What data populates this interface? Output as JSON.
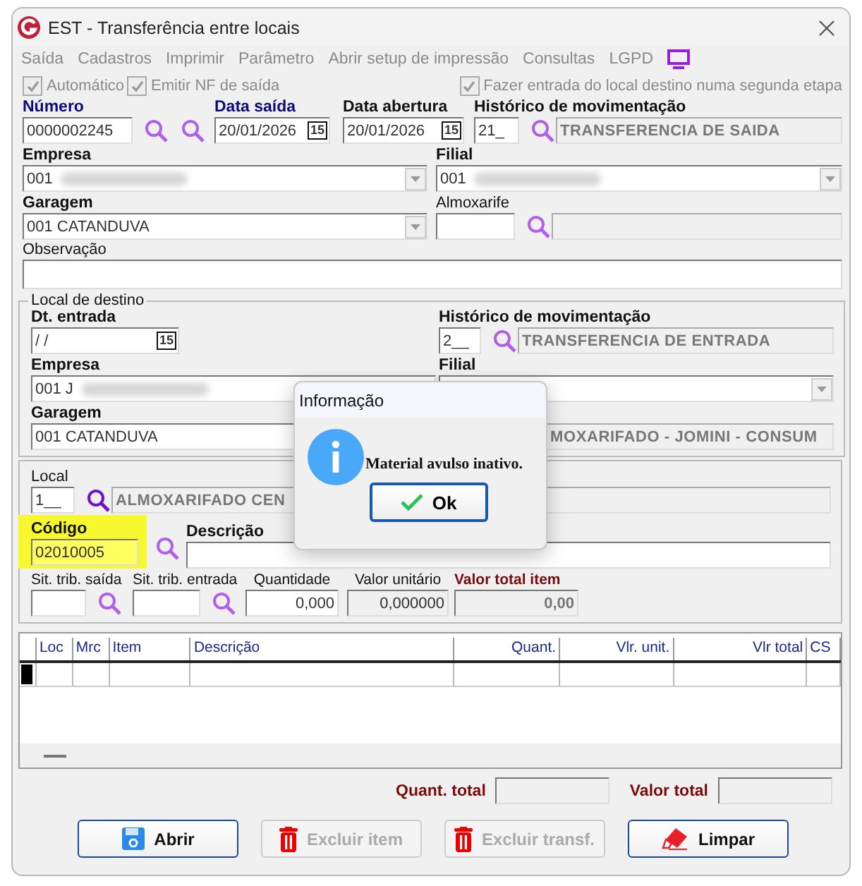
{
  "window": {
    "title": "EST - Transferência entre locais"
  },
  "menu": [
    {
      "label": "Saída"
    },
    {
      "label": "Cadastros"
    },
    {
      "label": "Imprimir"
    },
    {
      "label": "Parâmetro"
    },
    {
      "label": "Abrir setup de impressão"
    },
    {
      "label": "Consultas"
    },
    {
      "label": "LGPD"
    }
  ],
  "options": [
    {
      "label": "Automático",
      "checked": true,
      "disabled": true
    },
    {
      "label": "Emitir NF de saída",
      "checked": true,
      "disabled": true
    }
  ],
  "option_right": {
    "label": "Fazer entrada do local destino numa segunda etapa",
    "checked": true,
    "disabled": true
  },
  "numero": {
    "label": "Número",
    "value": "0000002245"
  },
  "data_saida": {
    "label": "Data saída",
    "value": "20/01/2026",
    "calendar": "15"
  },
  "data_abertura": {
    "label": "Data abertura",
    "value": "20/01/2026",
    "calendar": "15"
  },
  "historico": {
    "label": "Histórico de movimentação",
    "code": "21_",
    "description": "TRANSFERENCIA DE SAIDA"
  },
  "empresa": {
    "label": "Empresa",
    "value": "001",
    "blurred": true
  },
  "filial": {
    "label": "Filial",
    "value": "001",
    "blurred": true
  },
  "garagem": {
    "label": "Garagem",
    "value": "001 CATANDUVA"
  },
  "almoxarife": {
    "label": "Almoxarife"
  },
  "observacao": {
    "label": "Observação"
  },
  "destino": {
    "title": "Local de destino",
    "dt_entrada": {
      "label": "Dt. entrada",
      "value": " / /",
      "calendar": "15"
    },
    "historico": {
      "label": "Histórico de movimentação",
      "code": "2__",
      "description": "TRANSFERENCIA DE ENTRADA"
    },
    "empresa": {
      "label": "Empresa",
      "value": "001 J",
      "blurred": true
    },
    "filial": {
      "label": "Filial"
    },
    "garagem": {
      "label": "Garagem",
      "value": "001 CATANDUVA"
    },
    "almoxarifado": "MOXARIFADO - JOMINI - CONSUM"
  },
  "local": {
    "label": "Local",
    "code": "1__",
    "description": "ALMOXARIFADO CEN"
  },
  "codigo": {
    "label": "Código",
    "value": "02010005",
    "highlighted": true
  },
  "descricao": {
    "label": "Descrição"
  },
  "sit_saida": {
    "label": "Sit. trib. saída"
  },
  "sit_entrada": {
    "label": "Sit. trib. entrada"
  },
  "quantidade": {
    "label": "Quantidade",
    "value": "0,000"
  },
  "valor_unitario": {
    "label": "Valor unitário",
    "value": "0,000000"
  },
  "valor_total_item": {
    "label": "Valor total item",
    "value": "0,00"
  },
  "table": {
    "columns": [
      "",
      "Loc",
      "Mrc",
      "Item",
      "Descrição",
      "Quant.",
      "Vlr. unit.",
      "Vlr total",
      "CS"
    ]
  },
  "totals": [
    {
      "label": "Quant. total"
    },
    {
      "label": "Valor total"
    }
  ],
  "buttons": [
    {
      "label": "Abrir",
      "kind": "save",
      "disabled": false
    },
    {
      "label": "Excluir item",
      "kind": "trash",
      "disabled": true
    },
    {
      "label": "Excluir transf.",
      "kind": "trash",
      "disabled": true
    },
    {
      "label": "Limpar",
      "kind": "eraser",
      "disabled": false
    }
  ],
  "dialog": {
    "title": "Informação",
    "message": "Material avulso inativo.",
    "button": "Ok"
  }
}
